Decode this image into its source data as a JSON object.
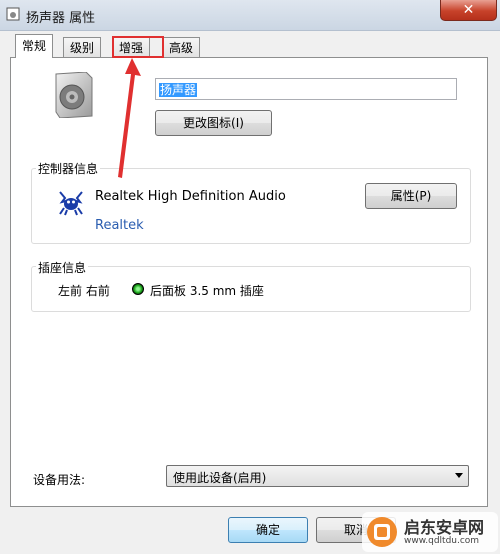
{
  "window": {
    "title": "扬声器 属性",
    "close_label": "✕"
  },
  "tabs": [
    {
      "label": "常规",
      "active": true
    },
    {
      "label": "级别",
      "active": false
    },
    {
      "label": "增强",
      "active": false
    },
    {
      "label": "高级",
      "active": false
    }
  ],
  "general": {
    "device_name_value": "扬声器",
    "change_icon_label": "更改图标(I)"
  },
  "controller": {
    "group_title": "控制器信息",
    "name": "Realtek High Definition Audio",
    "vendor": "Realtek",
    "properties_label": "属性(P)"
  },
  "jack": {
    "group_title": "插座信息",
    "channels": "左前 右前",
    "description": "后面板 3.5 mm 插座",
    "status_color": "#19a019"
  },
  "usage": {
    "label": "设备用法:",
    "selected": "使用此设备(启用)"
  },
  "footer": {
    "ok_label": "确定",
    "cancel_label": "取消"
  },
  "colors": {
    "highlight": "#e03030",
    "link": "#2a5db0",
    "accent": "#3399ff"
  },
  "watermark": {
    "text": "启东安卓网",
    "url": "www.qdltdu.com"
  }
}
